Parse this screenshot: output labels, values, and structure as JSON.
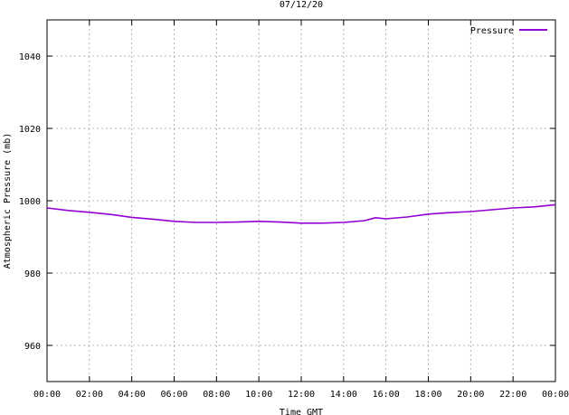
{
  "chart_data": {
    "type": "line",
    "title": "07/12/20",
    "xlabel": "Time GMT",
    "ylabel": "Atmospheric Pressure (mb)",
    "x_tick_labels": [
      "00:00",
      "02:00",
      "04:00",
      "06:00",
      "08:00",
      "10:00",
      "12:00",
      "14:00",
      "16:00",
      "18:00",
      "20:00",
      "22:00",
      "00:00"
    ],
    "xlim_hours": [
      0,
      24
    ],
    "y_ticks": [
      960,
      980,
      1000,
      1020,
      1040
    ],
    "ylim": [
      950,
      1050
    ],
    "grid": true,
    "legend_position": "top-right",
    "series": [
      {
        "name": "Pressure",
        "color": "#9400d3",
        "x_hours": [
          0,
          1,
          2,
          3,
          4,
          5,
          6,
          7,
          8,
          9,
          10,
          11,
          12,
          13,
          14,
          15,
          15.5,
          16,
          17,
          18,
          19,
          20,
          21,
          22,
          23,
          24
        ],
        "values": [
          998.0,
          997.3,
          996.8,
          996.2,
          995.4,
          994.9,
          994.3,
          994.0,
          994.0,
          994.1,
          994.3,
          994.1,
          993.8,
          993.8,
          994.0,
          994.5,
          995.3,
          995.0,
          995.5,
          996.3,
          996.7,
          997.0,
          997.5,
          998.0,
          998.3,
          998.9
        ]
      }
    ]
  }
}
